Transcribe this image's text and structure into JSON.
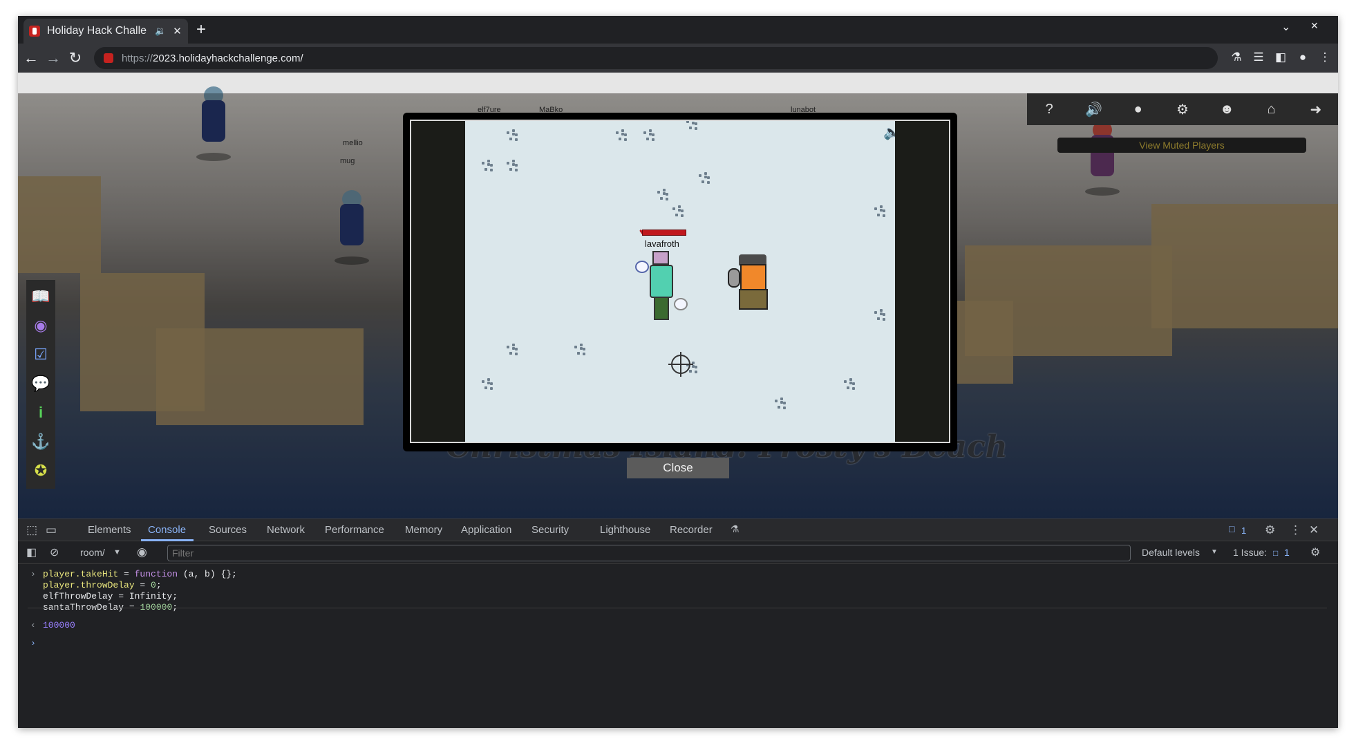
{
  "browser": {
    "tab_title": "Holiday Hack Challe",
    "new_tab": "+",
    "url_scheme": "https://",
    "url_host": "2023.holidayhackchallenge.com/"
  },
  "game_scene": {
    "nametags": [
      "elf7ure",
      "MaBko",
      "lunabot",
      "mellio",
      "mug"
    ],
    "view_muted_label": "View Muted Players",
    "location_banner": "Christmas Island: Frosty's Beach"
  },
  "modal": {
    "player_name": "lavafroth",
    "close_label": "Close"
  },
  "devtools": {
    "tabs": [
      "Elements",
      "Console",
      "Sources",
      "Network",
      "Performance",
      "Memory",
      "Application",
      "Security",
      "Lighthouse",
      "Recorder"
    ],
    "issues_badge": "1",
    "context": "room/",
    "filter_placeholder": "Filter",
    "levels": "Default levels",
    "issues_label": "1 Issue:",
    "issues_count": "1",
    "console_lines": {
      "l1_prop": "player.takeHit",
      "l1_rest": " = ",
      "l1_fn": "function",
      "l1_tail": " (a, b) {};",
      "l2_prop": "player.throwDelay",
      "l2_rest": " = ",
      "l2_num": "0",
      "l3": "elfThrowDelay = Infinity;",
      "l4_start": "santaThrowDelay = ",
      "l4_num": "100000",
      "result": "100000"
    }
  }
}
